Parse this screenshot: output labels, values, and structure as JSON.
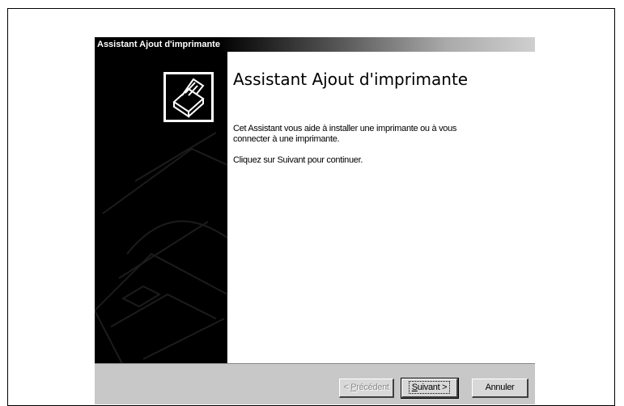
{
  "window": {
    "title": "Assistant Ajout d'imprimante"
  },
  "content": {
    "heading": "Assistant Ajout d'imprimante",
    "description": "Cet Assistant vous aide à installer une imprimante ou à vous connecter à une imprimante.",
    "prompt": "Cliquez sur Suivant pour continuer."
  },
  "buttons": {
    "previous": {
      "mnemonic": "P",
      "rest": "récédent",
      "prefix": "< "
    },
    "next": {
      "mnemonic": "S",
      "rest": "uivant",
      "suffix": " >"
    },
    "cancel": {
      "label": "Annuler"
    }
  },
  "icons": {
    "printer": "printer-icon"
  },
  "colors": {
    "titlebar_start": "#000000",
    "left_panel": "#000000",
    "footer": "#c8c8c8"
  }
}
